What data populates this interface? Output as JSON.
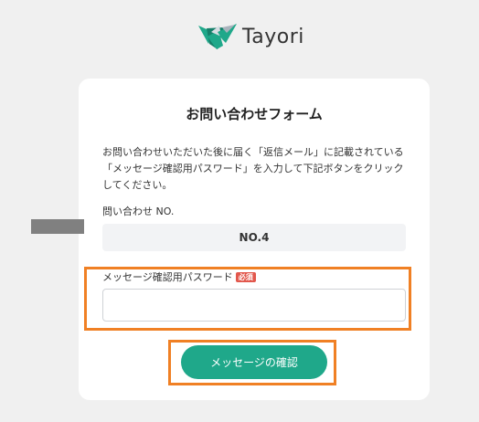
{
  "brand": {
    "name": "Tayori",
    "logo_icon": "tayori-bird-logo",
    "colors": {
      "primary": "#1fa88a",
      "dark": "#16806a"
    }
  },
  "form": {
    "title": "お問い合わせフォーム",
    "description": "お問い合わせいただいた後に届く「返信メール」に記載されている「メッセージ確認用パスワード」を入力して下記ボタンをクリックしてください。",
    "inquiry": {
      "label": "問い合わせ NO.",
      "value": "NO.4"
    },
    "password": {
      "label": "メッセージ確認用パスワード",
      "required_badge": "必須",
      "required_color": "#e2574c",
      "value": "",
      "masked": true
    },
    "submit": {
      "label": "メッセージの確認",
      "color": "#1fa88a"
    }
  },
  "annotations": {
    "highlight_color": "#f08024"
  }
}
